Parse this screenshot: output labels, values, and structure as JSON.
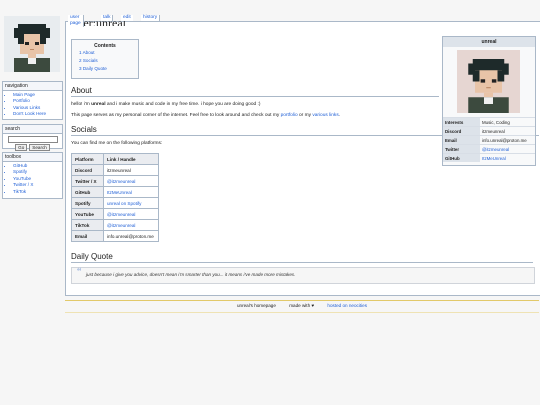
{
  "tabs": [
    {
      "label": "user page"
    },
    {
      "label": "talk"
    },
    {
      "label": "edit"
    },
    {
      "label": "history"
    }
  ],
  "page": {
    "title_fragment": "User:unreal"
  },
  "sidebar": {
    "navigation": {
      "heading": "navigation",
      "items": [
        "Main Page",
        "Portfolio",
        "Various Links",
        "Don't Look Here"
      ]
    },
    "search": {
      "heading": "search",
      "go_label": "Go",
      "search_label": "Search"
    },
    "toolbox": {
      "heading": "toolbox",
      "items": [
        "GitHub",
        "Spotify",
        "YouTube",
        "Twitter / X",
        "TikTok"
      ]
    }
  },
  "toc": {
    "title": "Contents",
    "items": [
      "1 About",
      "2 Socials",
      "3 Daily Quote"
    ]
  },
  "about": {
    "heading": "About",
    "line1_pre": "hello! i'm ",
    "line1_bold": "unreal",
    "line1_post": " and i make music and code in my free time. i hope you are doing good :)",
    "line2_pre": "This page serves as my personal corner of the internet. Feel free to look around and check out my ",
    "line2_link1": "portfolio",
    "line2_mid": " or my ",
    "line2_link2": "various links",
    "line2_post": "."
  },
  "socials": {
    "heading": "Socials",
    "intro": "You can find me on the following platforms:",
    "headers": [
      "Platform",
      "Link / Handle"
    ],
    "rows": [
      {
        "platform": "Discord",
        "handle": "itzmeunreal",
        "link": false
      },
      {
        "platform": "Twitter / X",
        "handle": "@itzmeunreal",
        "link": true
      },
      {
        "platform": "GitHub",
        "handle": "ItzMeUnreal",
        "link": true
      },
      {
        "platform": "Spotify",
        "handle": "unreal on Spotify",
        "link": true
      },
      {
        "platform": "YouTube",
        "handle": "@itzmeunreal",
        "link": true
      },
      {
        "platform": "TikTok",
        "handle": "@itzmeunreal",
        "link": true
      },
      {
        "platform": "Email",
        "handle": "info.unreal@proton.me",
        "link": false
      }
    ]
  },
  "quote": {
    "heading": "Daily Quote",
    "mark": "“",
    "text": "just because i give you advice, doesn't mean i'm smarter than you... it means i've made more mistakes."
  },
  "infobox": {
    "title": "unreal",
    "rows": [
      {
        "label": "Interests",
        "value": "Music, Coding",
        "link": false
      },
      {
        "label": "Discord",
        "value": "itzmeunreal",
        "link": false
      },
      {
        "label": "Email",
        "value": "info.unreal@proton.me",
        "link": false
      },
      {
        "label": "Twitter",
        "value": "@itzmeunreal",
        "link": true
      },
      {
        "label": "GitHub",
        "value": "ItzMeUnreal",
        "link": true
      }
    ]
  },
  "footer": {
    "homepage": "unreal's homepage",
    "made_with": "made with ♥",
    "hosted": "hosted on neocities"
  },
  "colors": {
    "link": "#1f5fd6",
    "border": "#aab8c8",
    "footer_rule": "#e2c96a"
  }
}
